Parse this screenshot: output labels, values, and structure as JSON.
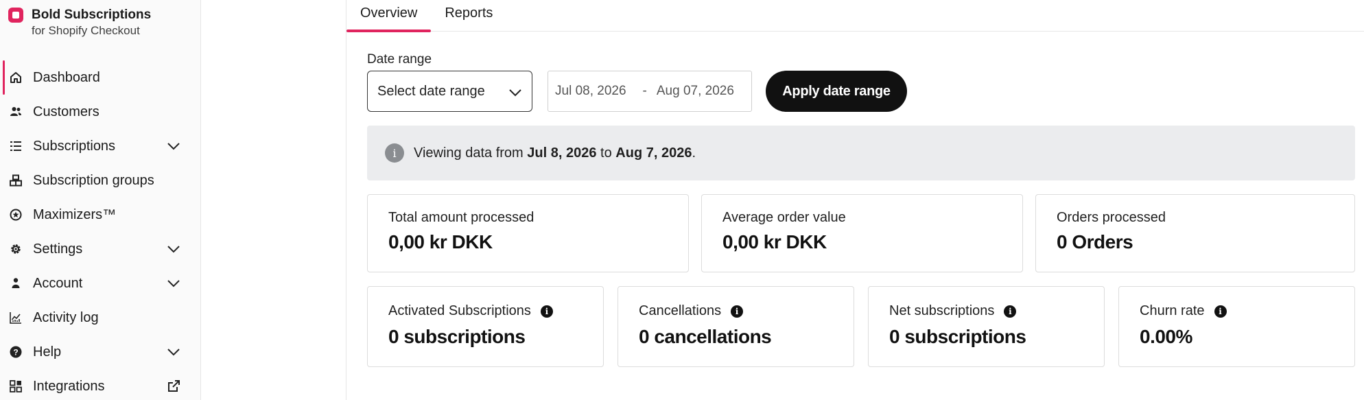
{
  "brand": {
    "name": "Bold Subscriptions",
    "subtitle": "for Shopify Checkout"
  },
  "sidebar": {
    "items": [
      {
        "label": "Dashboard",
        "icon": "home-icon",
        "active": true
      },
      {
        "label": "Customers",
        "icon": "users-icon"
      },
      {
        "label": "Subscriptions",
        "icon": "list-icon",
        "chevron": "chevron-down-icon"
      },
      {
        "label": "Subscription groups",
        "icon": "boxes-icon"
      },
      {
        "label": "Maximizers™",
        "icon": "star-badge-icon"
      },
      {
        "label": "Settings",
        "icon": "gear-icon",
        "chevron": "chevron-down-icon"
      },
      {
        "label": "Account",
        "icon": "person-icon",
        "chevron": "chevron-down-icon"
      },
      {
        "label": "Activity log",
        "icon": "chart-icon"
      },
      {
        "label": "Help",
        "icon": "help-icon",
        "chevron": "chevron-down-icon"
      },
      {
        "label": "Integrations",
        "icon": "grid-icon",
        "trailing": "external-link-icon"
      }
    ]
  },
  "tabs": [
    {
      "label": "Overview",
      "active": true
    },
    {
      "label": "Reports"
    }
  ],
  "date_range": {
    "label": "Date range",
    "select_placeholder": "Select date range",
    "start": "Jul 08, 2026",
    "separator": "-",
    "end": "Aug 07, 2026",
    "apply_label": "Apply date range"
  },
  "info_banner": {
    "prefix": "Viewing data from",
    "from": "Jul 8, 2026",
    "middle": "to",
    "to": "Aug 7, 2026",
    "suffix": "."
  },
  "stats_row1": [
    {
      "label": "Total amount processed",
      "value": "0,00 kr DKK"
    },
    {
      "label": "Average order value",
      "value": "0,00 kr DKK"
    },
    {
      "label": "Orders processed",
      "value": "0 Orders"
    }
  ],
  "stats_row2": [
    {
      "label": "Activated Subscriptions",
      "value": "0 subscriptions"
    },
    {
      "label": "Cancellations",
      "value": "0 cancellations"
    },
    {
      "label": "Net subscriptions",
      "value": "0 subscriptions"
    },
    {
      "label": "Churn rate",
      "value": "0.00%"
    }
  ],
  "colors": {
    "accent": "#e0245e",
    "button_bg": "#111111",
    "banner_bg": "#ebecee"
  }
}
